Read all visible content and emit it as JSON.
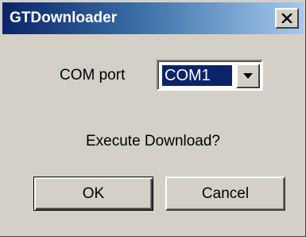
{
  "window": {
    "title": "GTDownloader",
    "close_label": "close"
  },
  "form": {
    "com_port_label": "COM port",
    "com_port_value": "COM1",
    "prompt": "Execute Download?"
  },
  "buttons": {
    "ok_label": "OK",
    "cancel_label": "Cancel"
  },
  "icons": {
    "close": "close-icon",
    "dropdown": "chevron-down-icon"
  },
  "colors": {
    "title_bar_start": "#0a246a",
    "title_bar_end": "#a6caf0",
    "face": "#d4d0c8",
    "selection": "#0a246a"
  }
}
